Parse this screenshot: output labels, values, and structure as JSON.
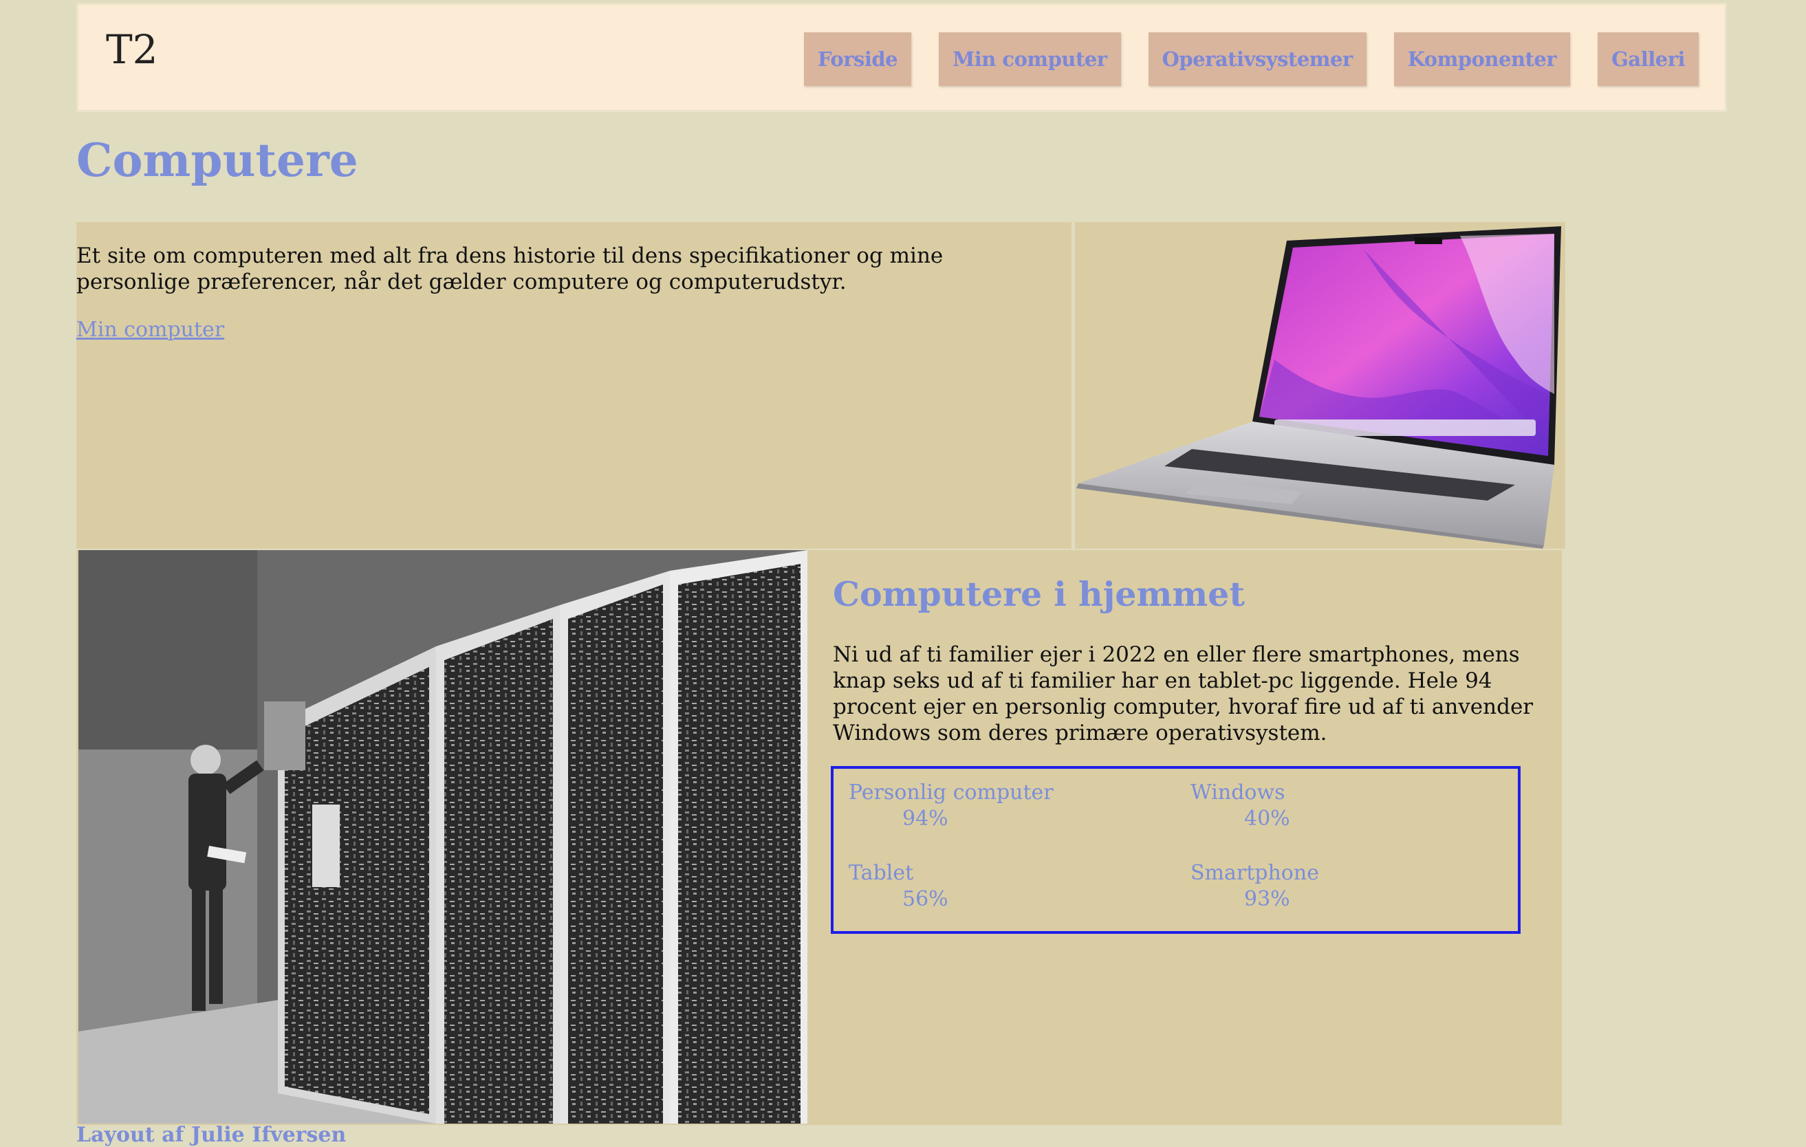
{
  "header": {
    "logo": "T2",
    "nav": [
      "Forside",
      "Min computer",
      "Operativsystemer",
      "Komponenter",
      "Galleri"
    ]
  },
  "page": {
    "title": "Computere"
  },
  "intro": {
    "text": "Et site om computeren med alt fra dens historie til dens specifikationer og mine personlige præferencer, når det gælder computere og computerudstyr.",
    "link": "Min computer"
  },
  "home": {
    "title": "Computere i hjemmet",
    "text": "Ni ud af ti familier ejer i 2022 en eller flere smartphones, mens knap seks ud af ti familier har en tablet-pc liggende. Hele 94 procent ejer en personlig computer, hvoraf fire ud af ti anvender Windows som deres primære operativsystem."
  },
  "stats": [
    {
      "label": "Personlig computer",
      "value": "94%"
    },
    {
      "label": "Windows",
      "value": "40%"
    },
    {
      "label": "Tablet",
      "value": "56%"
    },
    {
      "label": "Smartphone",
      "value": "93%"
    }
  ],
  "footer": {
    "text": "Layout af Julie Ifversen"
  },
  "colors": {
    "background": "#e0dcc0",
    "header_bg": "#fcebd5",
    "nav_bg": "#d9b59e",
    "accent": "#7c8ed8",
    "panel_bg": "#dacda4",
    "stats_border": "#1e1ee8"
  }
}
